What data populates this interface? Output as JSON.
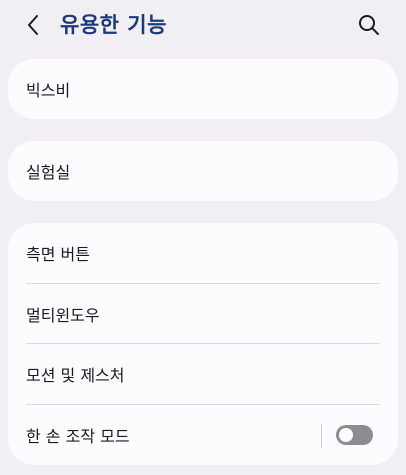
{
  "header": {
    "title": "유용한 기능",
    "back_icon": "chevron-left-icon",
    "search_icon": "search-icon"
  },
  "cards": {
    "bixby": {
      "label": "빅스비"
    },
    "labs": {
      "label": "실험실"
    }
  },
  "group": {
    "items": [
      {
        "label": "측면 버튼"
      },
      {
        "label": "멀티윈도우"
      },
      {
        "label": "모션 및 제스처"
      },
      {
        "label": "한 손 조작 모드",
        "toggle": false
      }
    ]
  },
  "colors": {
    "background": "#f1eff4",
    "card": "#fcfcfe",
    "title": "#1d3a78",
    "toggle_off": "#8e8c93"
  }
}
